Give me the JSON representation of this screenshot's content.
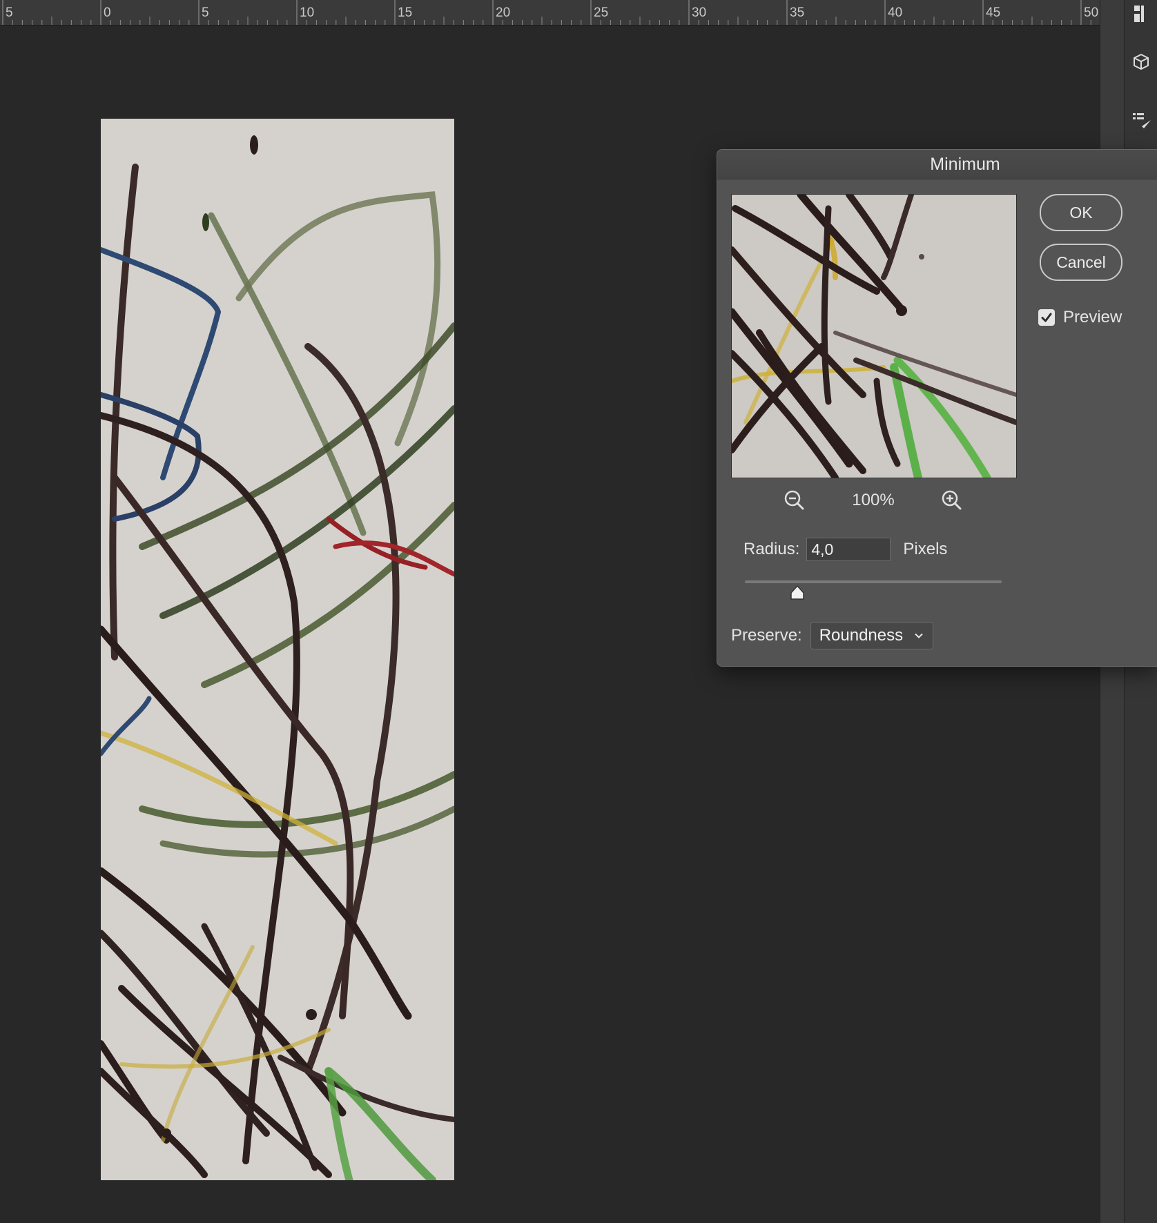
{
  "ruler": {
    "labels": [
      "5",
      "0",
      "5",
      "10",
      "15",
      "20",
      "25",
      "30",
      "35",
      "40",
      "45",
      "50"
    ]
  },
  "dialog": {
    "title": "Minimum",
    "ok_label": "OK",
    "cancel_label": "Cancel",
    "preview_label": "Preview",
    "preview_checked": true,
    "zoom_level": "100%",
    "radius_label": "Radius:",
    "radius_value": "4,0",
    "radius_unit": "Pixels",
    "preserve_label": "Preserve:",
    "preserve_value": "Roundness"
  },
  "icons": {
    "zoom_out": "zoom-out-icon",
    "zoom_in": "zoom-in-icon",
    "checkmark": "checkmark-icon",
    "chevron": "chevron-down-icon",
    "slider_thumb": "slider-thumb-icon"
  },
  "colors": {
    "canvas_bg": "#282828",
    "dialog_bg": "#535353",
    "ruler_bg": "#3a3a3a"
  }
}
